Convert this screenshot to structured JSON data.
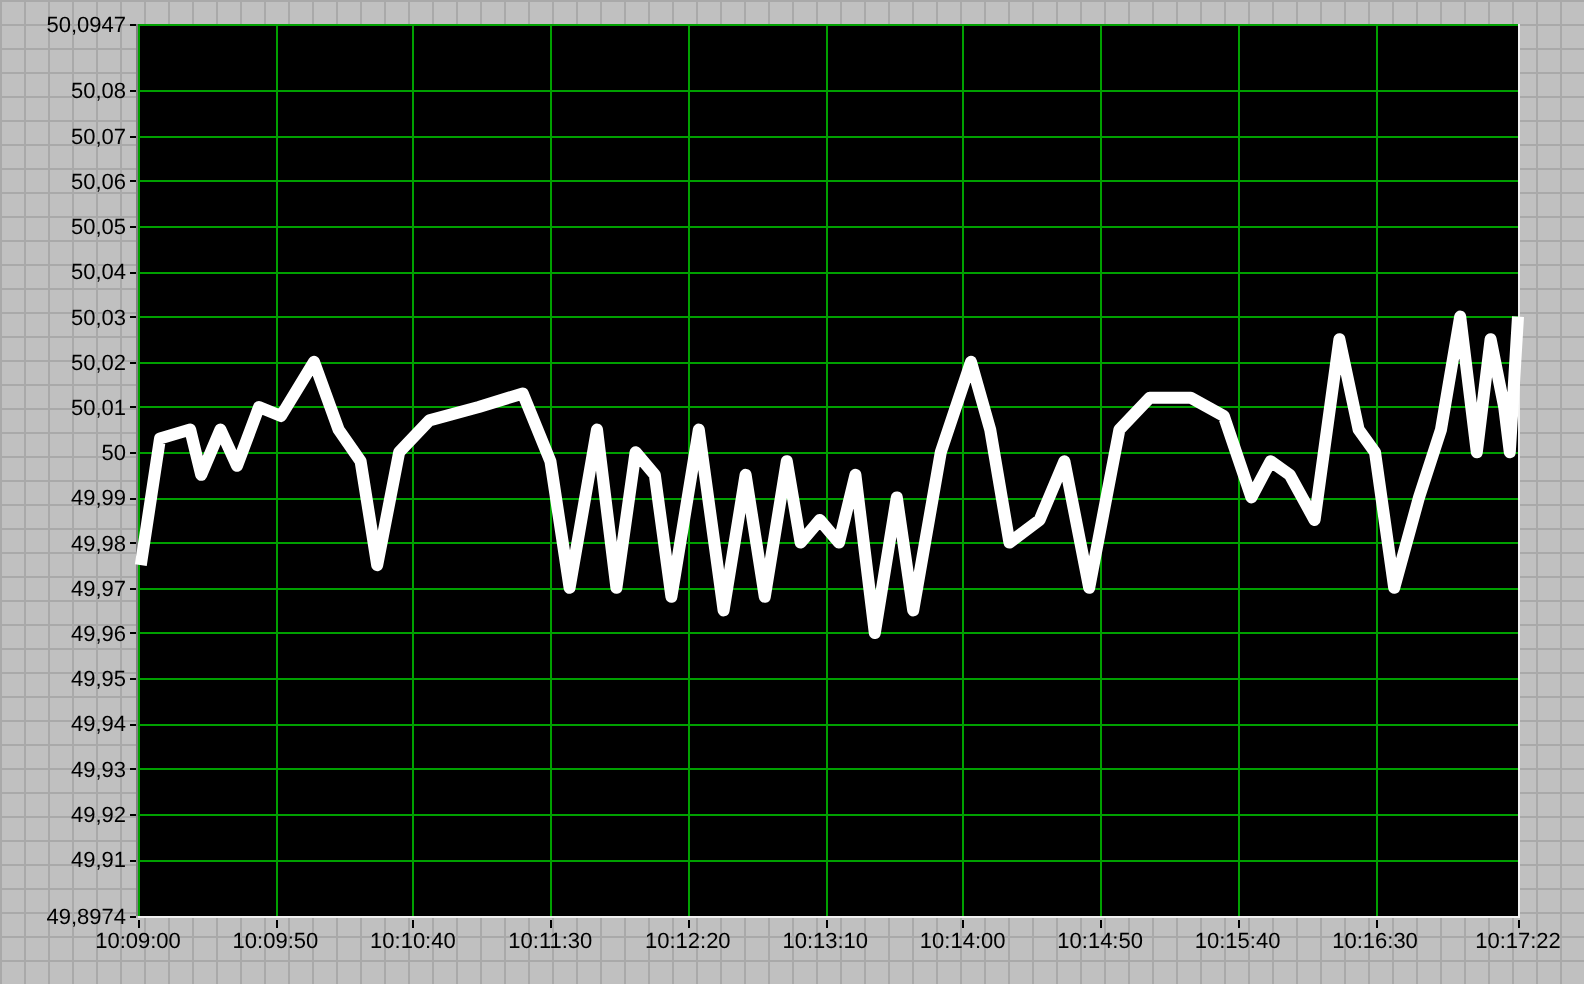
{
  "chart": {
    "chart_data": {
      "type": "line",
      "grid": true,
      "xlim": [
        36540,
        37042
      ],
      "ylim": [
        49.8974,
        50.0947
      ],
      "xticks": [
        {
          "value": 36540,
          "label": "10:09:00"
        },
        {
          "value": 36590,
          "label": "10:09:50"
        },
        {
          "value": 36640,
          "label": "10:10:40"
        },
        {
          "value": 36690,
          "label": "10:11:30"
        },
        {
          "value": 36740,
          "label": "10:12:20"
        },
        {
          "value": 36790,
          "label": "10:13:10"
        },
        {
          "value": 36840,
          "label": "10:14:00"
        },
        {
          "value": 36890,
          "label": "10:14:50"
        },
        {
          "value": 36940,
          "label": "10:15:40"
        },
        {
          "value": 36990,
          "label": "10:16:30"
        },
        {
          "value": 37042,
          "label": "10:17:22"
        }
      ],
      "yticks": [
        {
          "value": 50.0947,
          "label": "50,0947"
        },
        {
          "value": 50.08,
          "label": "50,08"
        },
        {
          "value": 50.07,
          "label": "50,07"
        },
        {
          "value": 50.06,
          "label": "50,06"
        },
        {
          "value": 50.05,
          "label": "50,05"
        },
        {
          "value": 50.04,
          "label": "50,04"
        },
        {
          "value": 50.03,
          "label": "50,03"
        },
        {
          "value": 50.02,
          "label": "50,02"
        },
        {
          "value": 50.01,
          "label": "50,01"
        },
        {
          "value": 50,
          "label": "50"
        },
        {
          "value": 49.99,
          "label": "49,99"
        },
        {
          "value": 49.98,
          "label": "49,98"
        },
        {
          "value": 49.97,
          "label": "49,97"
        },
        {
          "value": 49.96,
          "label": "49,96"
        },
        {
          "value": 49.95,
          "label": "49,95"
        },
        {
          "value": 49.94,
          "label": "49,94"
        },
        {
          "value": 49.93,
          "label": "49,93"
        },
        {
          "value": 49.92,
          "label": "49,92"
        },
        {
          "value": 49.91,
          "label": "49,91"
        },
        {
          "value": 49.8974,
          "label": "49,8974"
        }
      ],
      "x": [
        36541,
        36548,
        36559,
        36563,
        36570,
        36576,
        36584,
        36592,
        36604,
        36613,
        36621,
        36627,
        36635,
        36646,
        36664,
        36680,
        36690,
        36697,
        36707,
        36714,
        36721,
        36728,
        36734,
        36744,
        36753,
        36761,
        36768,
        36776,
        36781,
        36788,
        36795,
        36801,
        36808,
        36816,
        36822,
        36832,
        36843,
        36850,
        36857,
        36868,
        36877,
        36886,
        36897,
        36908,
        36923,
        36935,
        36945,
        36952,
        36959,
        36968,
        36977,
        36984,
        36990,
        36997,
        37006,
        37014,
        37021,
        37027,
        37032,
        37037,
        37039,
        37042
      ],
      "series": [
        {
          "color": "#ffffff",
          "values": [
            49.975,
            50.003,
            50.005,
            49.995,
            50.005,
            49.997,
            50.01,
            50.008,
            50.02,
            50.005,
            49.998,
            49.975,
            50.0,
            50.007,
            50.01,
            50.013,
            49.998,
            49.97,
            50.005,
            49.97,
            50.0,
            49.995,
            49.968,
            50.005,
            49.965,
            49.995,
            49.968,
            49.998,
            49.98,
            49.985,
            49.98,
            49.995,
            49.96,
            49.99,
            49.965,
            50.0,
            50.02,
            50.005,
            49.98,
            49.985,
            49.998,
            49.97,
            50.005,
            50.012,
            50.012,
            50.008,
            49.99,
            49.998,
            49.995,
            49.985,
            50.025,
            50.005,
            50.0,
            49.97,
            49.99,
            50.005,
            50.03,
            50.0,
            50.025,
            50.01,
            50.0,
            50.03
          ]
        }
      ]
    }
  }
}
